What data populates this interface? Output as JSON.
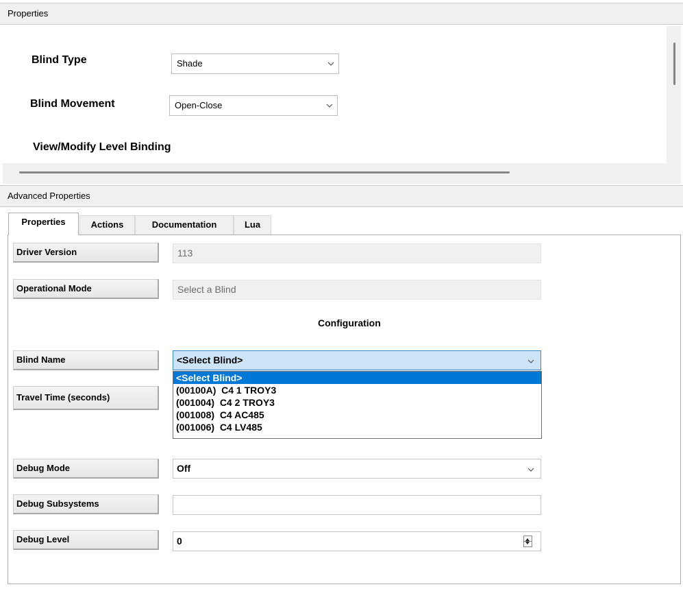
{
  "properties_panel": {
    "header": "Properties",
    "blind_type": {
      "label": "Blind Type",
      "value": "Shade"
    },
    "blind_movement": {
      "label": "Blind Movement",
      "value": "Open-Close"
    },
    "level_binding_label": "View/Modify Level Binding"
  },
  "advanced": {
    "header": "Advanced Properties",
    "tabs": [
      {
        "label": "Properties",
        "active": true
      },
      {
        "label": "Actions"
      },
      {
        "label": "Documentation"
      },
      {
        "label": "Lua"
      }
    ],
    "driver_version": {
      "label": "Driver Version",
      "value": "113"
    },
    "operational_mode": {
      "label": "Operational Mode",
      "value": "Select a Blind"
    },
    "section_title": "Configuration",
    "blind_name": {
      "label": "Blind Name",
      "value": "<Select Blind>",
      "options": [
        "<Select Blind>",
        "(00100A)  C4 1 TROY3",
        "(001004)  C4 2 TROY3",
        "(001008)  C4 AC485",
        "(001006)  C4 LV485"
      ]
    },
    "travel_time": {
      "label": "Travel Time (seconds)"
    },
    "debug_mode": {
      "label": "Debug Mode",
      "value": "Off"
    },
    "debug_subsystems": {
      "label": "Debug Subsystems",
      "value": ""
    },
    "debug_level": {
      "label": "Debug Level",
      "value": "0"
    }
  },
  "icons": {
    "dropdown_arrow": "chevron-down-icon",
    "spinner": "up-down-spinner-icon"
  }
}
